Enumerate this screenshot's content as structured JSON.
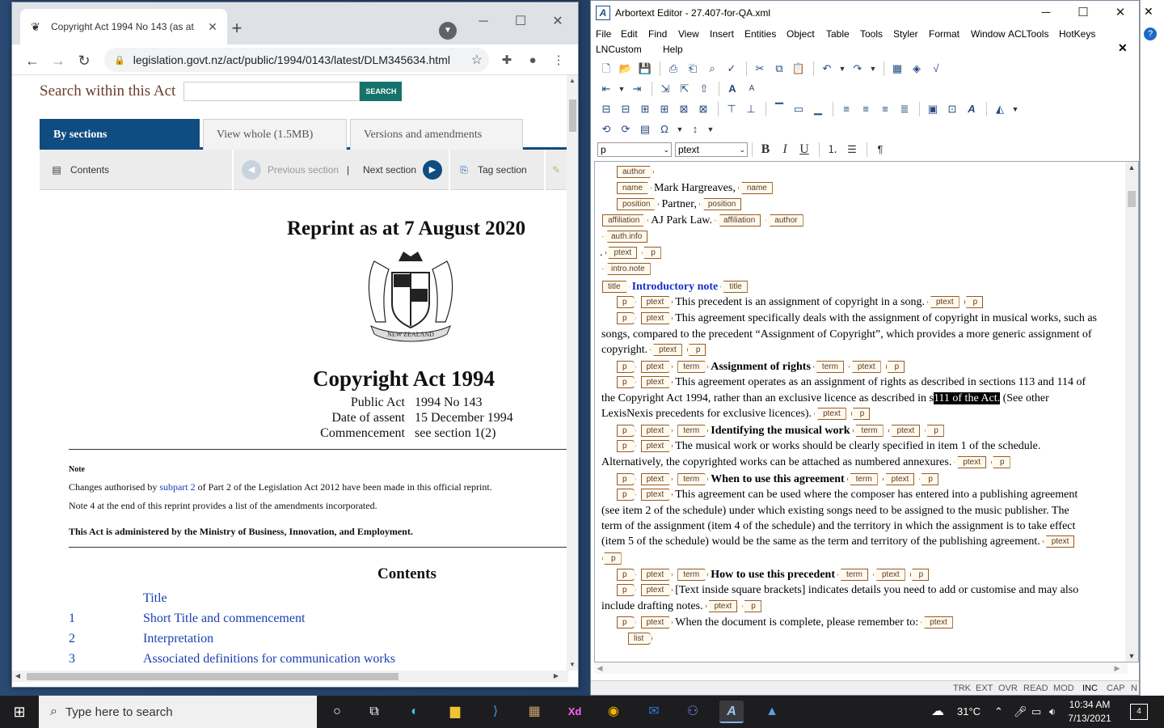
{
  "chrome": {
    "tab_title": "Copyright Act 1994 No 143 (as at",
    "url": "legislation.govt.nz/act/public/1994/0143/latest/DLM345634.html"
  },
  "legislation": {
    "search_label": "Search within this Act",
    "search_button": "SEARCH",
    "tabs": [
      "By sections",
      "View whole (1.5MB)",
      "Versions and amendments"
    ],
    "tools": {
      "contents": "Contents",
      "previous": "Previous section",
      "divider": "|",
      "next": "Next section",
      "tag": "Tag section"
    },
    "reprint": "Reprint as at 7 August 2020",
    "crest_text": "NEW ZEALAND",
    "title": "Copyright Act 1994",
    "meta_labels": [
      "Public Act",
      "Date of assent",
      "Commencement"
    ],
    "meta_values": [
      "1994 No 143",
      "15 December 1994",
      "see section 1(2)"
    ],
    "note_heading": "Note",
    "note_line1_a": "Changes authorised by ",
    "note_line1_link": "subpart 2",
    "note_line1_b": " of Part 2 of the Legislation Act 2012 have been made in this official reprint.",
    "note_line2": "Note 4 at the end of this reprint provides a list of the amendments incorporated.",
    "administered": "This Act is administered by the Ministry of Business, Innovation, and Employment.",
    "contents_heading": "Contents",
    "toc": [
      {
        "num": "",
        "text": "Title"
      },
      {
        "num": "1",
        "text": "Short Title and commencement"
      },
      {
        "num": "2",
        "text": "Interpretation"
      },
      {
        "num": "3",
        "text": "Associated definitions for communication works"
      }
    ]
  },
  "arbortext": {
    "window_title": "Arbortext Editor - 27.407-for-QA.xml",
    "menus": [
      "File",
      "Edit",
      "Find",
      "View",
      "Insert",
      "Entities",
      "Object",
      "Table",
      "Tools",
      "Styler",
      "Format",
      "Window",
      "ACLTools",
      "HotKeys",
      "LNCustom",
      "Help"
    ],
    "element_combo": "p",
    "style_combo": "ptext",
    "tags": {
      "author": "author",
      "name": "name",
      "position": "position",
      "affiliation": "affiliation",
      "auth_info": "auth.info",
      "ptext": "ptext",
      "p": "p",
      "intro_note": "intro.note",
      "title": "title",
      "term": "term",
      "list": "list"
    },
    "text": {
      "name_val": "Mark Hargreaves,",
      "position_val": "Partner,",
      "affiliation_val": "AJ Park Law.",
      "dot": ".",
      "intro_title": "Introductory note",
      "p1": "This precedent is an assignment of copyright in a song.",
      "p2a": "This agreement specifically deals with the assignment of copyright in musical works, such as",
      "p2b": "songs, compared to the precedent “Assignment of Copyright”, which provides a more generic assignment of",
      "p2c": "copyright.",
      "term1": "Assignment of rights",
      "p3a": "This agreement operates as an assignment of rights as described in sections 113 and 114 of",
      "p3b_pre": "the Copyright Act 1994, rather than an exclusive licence as described in s",
      "p3b_sel": "111 of the Act.",
      "p3b_post": " (See other",
      "p3c": "LexisNexis precedents for exclusive licences).",
      "term2": "Identifying the musical work",
      "p4a": "The musical work or works should be clearly specified in item 1 of the schedule.",
      "p4b": "Alternatively, the copyrighted works can be attached as numbered annexures.",
      "term3": "When to use this agreement",
      "p5a": "This agreement can be used where the composer has entered into a publishing agreement",
      "p5b": "(see item 2 of the schedule) under which existing songs need to be assigned to the music publisher. The",
      "p5c": "term of the assignment (item 4 of the schedule) and the territory in which the assignment is to take effect",
      "p5d": "(item 5 of the schedule) would be the same as the term and territory of the publishing agreement.",
      "term4": "How to use this precedent",
      "p6a": "[Text inside square brackets] indicates details you need to add or customise and may also",
      "p6b": "include drafting notes.",
      "p7": "When the document is complete, please remember to:"
    },
    "status": [
      "TRK",
      "EXT",
      "OVR",
      "READ",
      "MOD",
      "INC",
      "CAP",
      "N"
    ]
  },
  "taskbar": {
    "search_placeholder": "Type here to search",
    "weather": "31°C",
    "time": "10:34 AM",
    "date": "7/13/2021",
    "notifications": "4"
  }
}
